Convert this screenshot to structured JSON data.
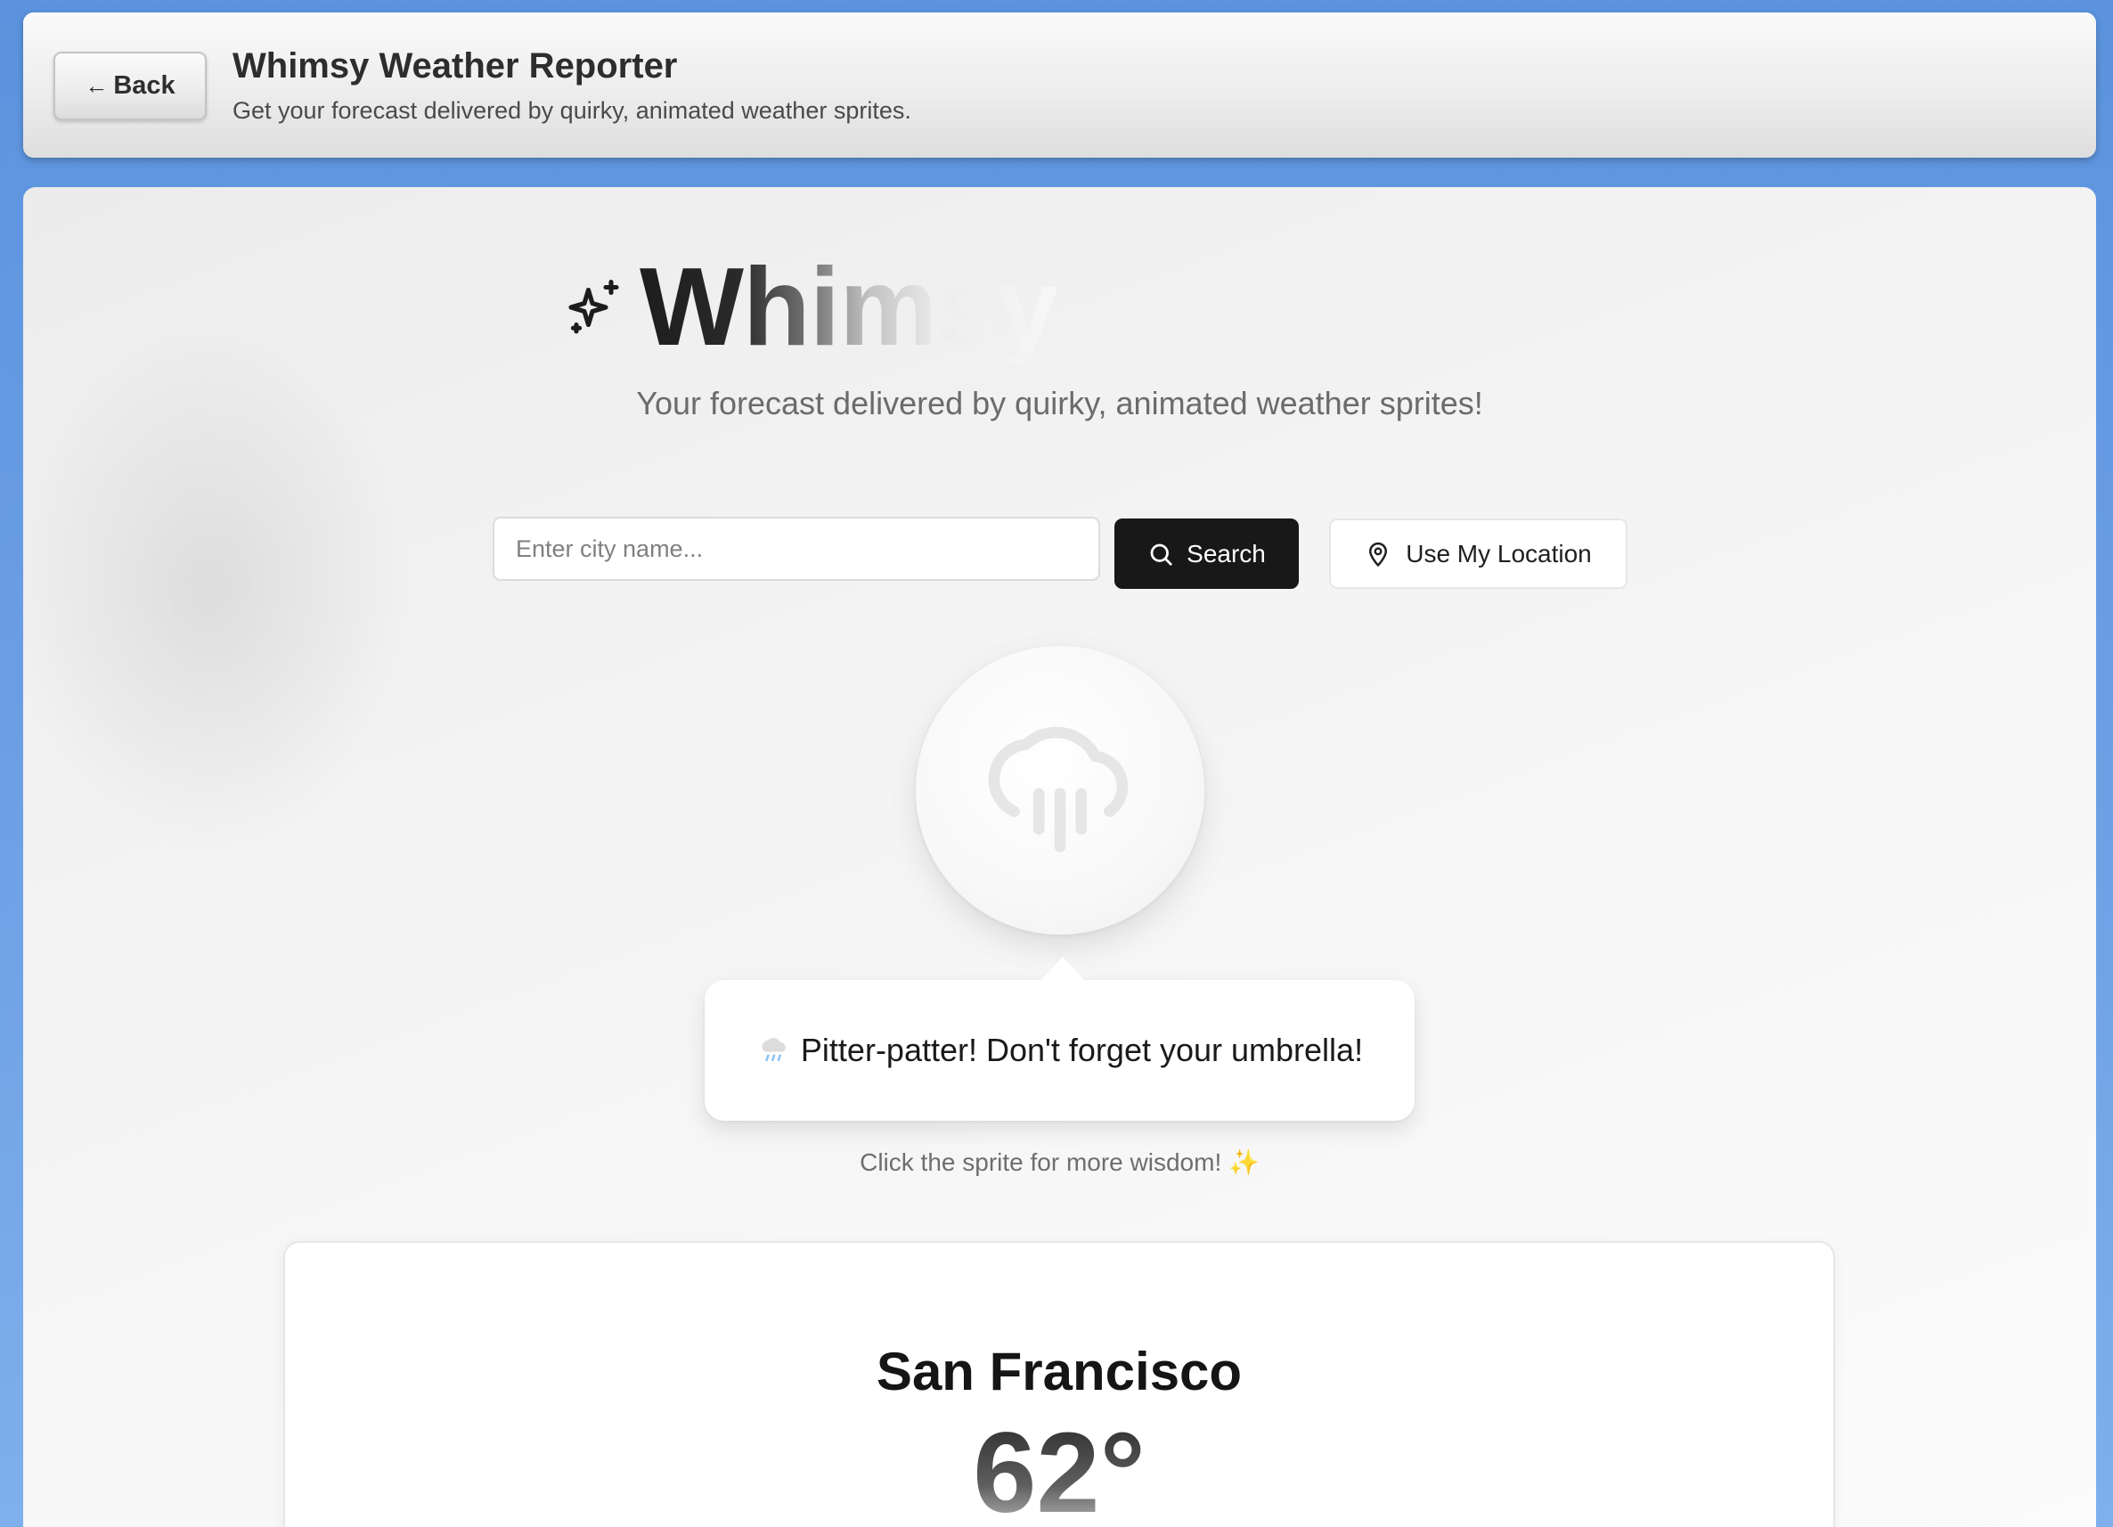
{
  "header": {
    "back_label": "Back",
    "title": "Whimsy Weather Reporter",
    "subtitle": "Get your forecast delivered by quirky, animated weather sprites."
  },
  "hero": {
    "brand_title": "Whimsy",
    "tagline": "Your forecast delivered by quirky, animated weather sprites!"
  },
  "search": {
    "placeholder": "Enter city name...",
    "value": "",
    "search_label": "Search",
    "location_label": "Use My Location"
  },
  "sprite": {
    "icon": "cloud-rain-icon",
    "message": "Pitter-patter! Don't forget your umbrella!",
    "message_icon": "rain-cloud-emoji",
    "hint": "Click the sprite for more wisdom!",
    "hint_icon": "sparkles-emoji"
  },
  "weather": {
    "city": "San Francisco",
    "temperature": "62°"
  },
  "colors": {
    "background_blue": "#5b93de",
    "primary_button": "#181818",
    "sparkle_accent": "#e8c24a"
  }
}
